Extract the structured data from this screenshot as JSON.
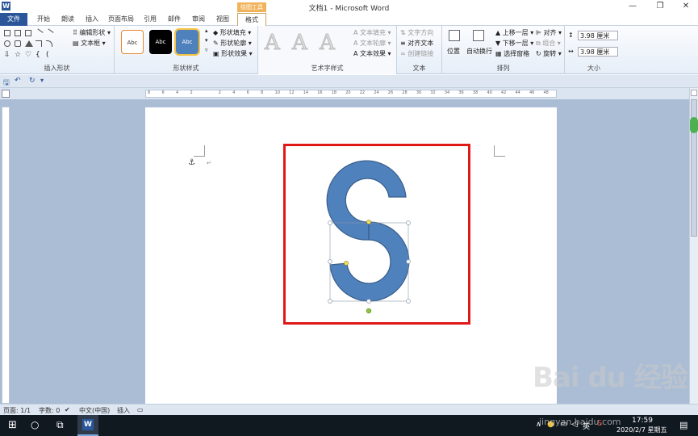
{
  "window": {
    "title": "文档1 - Microsoft Word",
    "app_icon": "W",
    "minimize": "—",
    "maximize": "❐",
    "close": "✕"
  },
  "tabs": {
    "context_label": "绘图工具",
    "items": [
      "文件",
      "开始",
      "朗读",
      "插入",
      "页面布局",
      "引用",
      "邮件",
      "审阅",
      "视图",
      "格式"
    ],
    "active": "格式"
  },
  "ribbon": {
    "insert_shapes": {
      "label": "插入形状",
      "edit_shape": "编辑形状",
      "text_box": "文本框"
    },
    "shape_styles": {
      "label": "形状样式",
      "thumbs": [
        "Abc",
        "Abc",
        "Abc"
      ],
      "fill": "形状填充",
      "outline": "形状轮廓",
      "effects": "形状效果"
    },
    "wordart": {
      "label": "艺术字样式",
      "letters": [
        "A",
        "A",
        "A"
      ],
      "text_fill": "文本填充",
      "text_outline": "文本轮廓",
      "text_effects": "文本效果"
    },
    "text": {
      "label": "文本",
      "direction": "文字方向",
      "align": "对齐文本",
      "link": "创建链接"
    },
    "arrange": {
      "label": "排列",
      "position": "位置",
      "wrap": "自动换行",
      "bring_forward": "上移一层",
      "send_backward": "下移一层",
      "selection_pane": "选择窗格",
      "align": "对齐",
      "group": "组合",
      "rotate": "旋转"
    },
    "size": {
      "label": "大小",
      "height": "3.98 厘米",
      "width": "3.98 厘米"
    }
  },
  "ruler": {
    "ticks": [
      "8",
      "6",
      "4",
      "2",
      "",
      "2",
      "4",
      "6",
      "8",
      "10",
      "12",
      "14",
      "16",
      "18",
      "20",
      "22",
      "24",
      "26",
      "28",
      "30",
      "32",
      "34",
      "36",
      "38",
      "40",
      "42",
      "44",
      "46",
      "48"
    ]
  },
  "document": {
    "anchor": "⚓",
    "para_mark": "↵"
  },
  "statusbar": {
    "page": "页面: 1/1",
    "words": "字数: 0",
    "language": "中文(中国)",
    "mode": "插入"
  },
  "taskbar": {
    "ime": "英",
    "time": "17:59",
    "date": "2020/2/7 星期五"
  },
  "watermark": {
    "text": "Bai du 经验",
    "url": "jingyan.baidu.com"
  },
  "colors": {
    "shape_fill": "#4f81bd",
    "shape_stroke": "#385d8a",
    "highlight_box": "#e01818",
    "file_tab": "#2b579a"
  }
}
